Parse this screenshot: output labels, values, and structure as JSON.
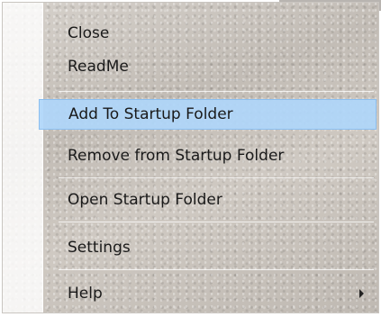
{
  "menu": {
    "items": [
      {
        "label": "Close"
      },
      {
        "label": "ReadMe"
      },
      {
        "label": "Add To Startup Folder",
        "highlighted": true
      },
      {
        "label": "Remove from Startup Folder"
      },
      {
        "label": "Open Startup Folder"
      },
      {
        "label": "Settings"
      },
      {
        "label": "Help",
        "has_submenu": true
      }
    ],
    "submenu_arrow_icon": "chevron-right-icon",
    "highlight_color": "#AFD6FA",
    "highlight_border_color": "#8CBFF0"
  }
}
